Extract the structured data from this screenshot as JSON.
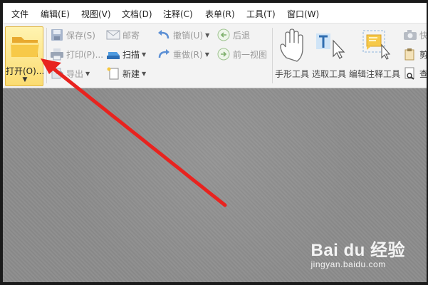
{
  "menubar": {
    "items": [
      {
        "label": "文件"
      },
      {
        "label": "编辑(E)"
      },
      {
        "label": "视图(V)"
      },
      {
        "label": "文档(D)"
      },
      {
        "label": "注释(C)"
      },
      {
        "label": "表单(R)"
      },
      {
        "label": "工具(T)"
      },
      {
        "label": "窗口(W)"
      }
    ]
  },
  "ribbon": {
    "open": {
      "label": "打开(O)...",
      "icon": "folder-icon"
    },
    "file_group": {
      "save": "保存(S)",
      "print": "打印(P)...",
      "export": "导出"
    },
    "share_group": {
      "mail": "邮寄",
      "scan": "扫描",
      "new": "新建"
    },
    "history_group": {
      "undo": "撤销(U)",
      "redo": "重做(R)"
    },
    "nav_group": {
      "back": "后退",
      "prev_view": "前一视图"
    },
    "tools": {
      "hand": "手形工具",
      "select_text": "选取工具",
      "edit_annot": "编辑注释工具"
    },
    "truncated": {
      "top": "快",
      "mid": "剪",
      "bottom": "查"
    }
  },
  "watermark": {
    "brand": "Bai du 经验",
    "url": "jingyan.baidu.com"
  },
  "colors": {
    "accent_red": "#e8231f",
    "open_button": "#fbdc72",
    "doc_background": "#8c8c8c"
  }
}
